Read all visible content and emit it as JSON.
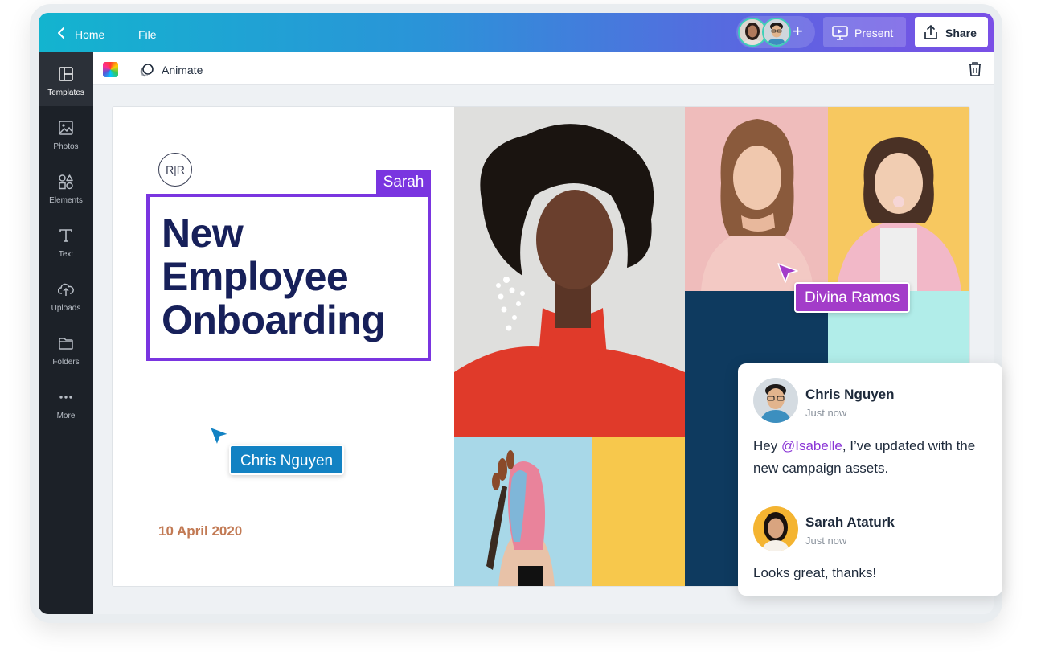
{
  "topbar": {
    "home_label": "Home",
    "file_label": "File",
    "present_label": "Present",
    "share_label": "Share"
  },
  "sidebar": {
    "items": [
      {
        "label": "Templates",
        "icon": "templates-icon"
      },
      {
        "label": "Photos",
        "icon": "photos-icon"
      },
      {
        "label": "Elements",
        "icon": "elements-icon"
      },
      {
        "label": "Text",
        "icon": "text-icon"
      },
      {
        "label": "Uploads",
        "icon": "uploads-icon"
      },
      {
        "label": "Folders",
        "icon": "folders-icon"
      },
      {
        "label": "More",
        "icon": "more-icon"
      }
    ]
  },
  "toolbar": {
    "animate_label": "Animate"
  },
  "canvas": {
    "logo_text": "R|R",
    "title_lines": [
      "New",
      "Employee",
      "Onboarding"
    ],
    "date": "10 April 2020",
    "collaborator_tags": {
      "sarah": "Sarah",
      "chris": "Chris Nguyen",
      "divina": "Divina Ramos"
    }
  },
  "comments": [
    {
      "author": "Chris Nguyen",
      "time": "Just now",
      "text_before": "Hey ",
      "mention": "@Isabelle",
      "text_after": ", I’ve updated with the new campaign assets."
    },
    {
      "author": "Sarah Ataturk",
      "time": "Just now",
      "text": "Looks great, thanks!"
    }
  ],
  "colors": {
    "accent_purple": "#7a35e0",
    "chris_blue": "#1282c3",
    "divina_purple": "#a33cc9",
    "title_navy": "#17205a",
    "date_copper": "#c27a54"
  }
}
